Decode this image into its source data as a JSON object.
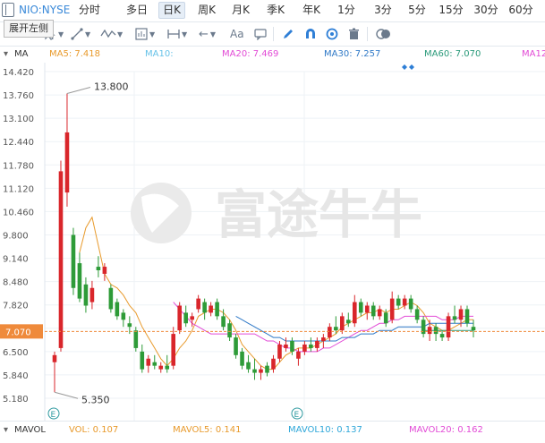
{
  "header": {
    "symbol": "NIO:NYSE",
    "tabs": [
      {
        "label": "分时",
        "active": false
      },
      {
        "label": "多日",
        "active": false
      },
      {
        "label": "日K",
        "active": true
      },
      {
        "label": "周K",
        "active": false
      },
      {
        "label": "月K",
        "active": false
      },
      {
        "label": "季K",
        "active": false
      },
      {
        "label": "年K",
        "active": false
      },
      {
        "label": "1分",
        "active": false
      },
      {
        "label": "3分",
        "active": false
      },
      {
        "label": "5分",
        "active": false
      },
      {
        "label": "15分",
        "active": false
      },
      {
        "label": "30分",
        "active": false
      },
      {
        "label": "60分",
        "active": false
      }
    ]
  },
  "tooltip": "展开左侧",
  "toolbar": {
    "icons": [
      "cursor-icon",
      "trendline-icon",
      "wave-pattern-icon",
      "indicator-icon",
      "measure-icon",
      "arrow-left-icon"
    ],
    "text_tool": "Aa"
  },
  "legend": {
    "ma_label": "MA",
    "ma5": "MA5: 7.418",
    "ma10": "MA10:",
    "ma20": "MA20: 7.469",
    "ma30": "MA30: 7.257",
    "ma60": "MA60: 7.070",
    "ma120": "MA12"
  },
  "colors": {
    "up": "#d9262b",
    "down": "#2e9b38",
    "ma5": "#e89a2c",
    "ma10": "#66c2e8",
    "ma20": "#e24bd6",
    "ma30": "#2f79c7",
    "ma60": "#2a9a7a",
    "price_line": "#ef8a3b",
    "accent": "#2f7fd6"
  },
  "watermark": "富途牛牛",
  "price_axis": {
    "ticks": [
      "14.420",
      "13.760",
      "13.100",
      "12.440",
      "11.780",
      "11.120",
      "10.460",
      "9.800",
      "9.140",
      "8.480",
      "7.820",
      "7.160",
      "6.500",
      "5.840",
      "5.180"
    ],
    "current": "7.070"
  },
  "annotations": {
    "high": "13.800",
    "low": "5.350",
    "event_marker": "E"
  },
  "volume_bar": {
    "label": "MAVOL",
    "vol": "VOL: 0.107",
    "mavol5": "MAVOL5: 0.141",
    "mavol10": "MAVOL10: 0.137",
    "mavol20": "MAVOL20: 0.162"
  },
  "chart_data": {
    "type": "candlestick",
    "ylim": [
      5.18,
      14.42
    ],
    "current_price": 7.07,
    "high": 13.8,
    "low": 5.35,
    "candles": [
      {
        "o": 6.2,
        "h": 6.5,
        "l": 5.35,
        "c": 6.4,
        "up": true
      },
      {
        "o": 6.6,
        "h": 11.9,
        "l": 6.5,
        "c": 11.6,
        "up": true
      },
      {
        "o": 11.0,
        "h": 13.8,
        "l": 10.6,
        "c": 12.7,
        "up": true
      },
      {
        "o": 9.8,
        "h": 10.0,
        "l": 8.1,
        "c": 8.3,
        "up": false
      },
      {
        "o": 9.0,
        "h": 9.3,
        "l": 7.9,
        "c": 8.0,
        "up": false
      },
      {
        "o": 8.4,
        "h": 8.6,
        "l": 7.6,
        "c": 7.8,
        "up": false
      },
      {
        "o": 7.9,
        "h": 8.5,
        "l": 7.7,
        "c": 8.3,
        "up": true
      },
      {
        "o": 8.9,
        "h": 9.2,
        "l": 8.6,
        "c": 8.8,
        "up": false
      },
      {
        "o": 8.7,
        "h": 9.0,
        "l": 8.5,
        "c": 8.9,
        "up": true
      },
      {
        "o": 8.3,
        "h": 8.4,
        "l": 7.6,
        "c": 7.7,
        "up": false
      },
      {
        "o": 7.9,
        "h": 8.0,
        "l": 7.4,
        "c": 7.5,
        "up": false
      },
      {
        "o": 7.6,
        "h": 7.7,
        "l": 7.2,
        "c": 7.4,
        "up": false
      },
      {
        "o": 7.3,
        "h": 7.5,
        "l": 7.0,
        "c": 7.2,
        "up": false
      },
      {
        "o": 7.1,
        "h": 7.2,
        "l": 6.5,
        "c": 6.6,
        "up": false
      },
      {
        "o": 6.5,
        "h": 6.7,
        "l": 5.9,
        "c": 6.0,
        "up": false
      },
      {
        "o": 6.1,
        "h": 6.4,
        "l": 5.9,
        "c": 6.3,
        "up": true
      },
      {
        "o": 6.2,
        "h": 6.4,
        "l": 6.0,
        "c": 6.1,
        "up": false
      },
      {
        "o": 6.0,
        "h": 6.2,
        "l": 5.9,
        "c": 6.1,
        "up": true
      },
      {
        "o": 6.1,
        "h": 6.4,
        "l": 5.9,
        "c": 6.0,
        "up": false
      },
      {
        "o": 6.1,
        "h": 7.2,
        "l": 6.0,
        "c": 7.0,
        "up": true
      },
      {
        "o": 7.1,
        "h": 7.9,
        "l": 7.0,
        "c": 7.8,
        "up": true
      },
      {
        "o": 7.6,
        "h": 7.8,
        "l": 7.2,
        "c": 7.3,
        "up": false
      },
      {
        "o": 7.4,
        "h": 7.6,
        "l": 7.2,
        "c": 7.5,
        "up": true
      },
      {
        "o": 7.7,
        "h": 8.1,
        "l": 7.6,
        "c": 8.0,
        "up": true
      },
      {
        "o": 7.9,
        "h": 8.0,
        "l": 7.4,
        "c": 7.6,
        "up": false
      },
      {
        "o": 7.6,
        "h": 7.9,
        "l": 7.5,
        "c": 7.8,
        "up": true
      },
      {
        "o": 7.9,
        "h": 8.0,
        "l": 7.4,
        "c": 7.5,
        "up": false
      },
      {
        "o": 7.5,
        "h": 7.7,
        "l": 7.1,
        "c": 7.2,
        "up": false
      },
      {
        "o": 7.3,
        "h": 7.4,
        "l": 6.8,
        "c": 6.9,
        "up": false
      },
      {
        "o": 6.9,
        "h": 7.0,
        "l": 6.3,
        "c": 6.4,
        "up": false
      },
      {
        "o": 6.5,
        "h": 6.6,
        "l": 6.0,
        "c": 6.1,
        "up": false
      },
      {
        "o": 6.2,
        "h": 6.4,
        "l": 5.9,
        "c": 6.0,
        "up": false
      },
      {
        "o": 6.0,
        "h": 6.3,
        "l": 5.7,
        "c": 5.9,
        "up": false
      },
      {
        "o": 5.9,
        "h": 6.1,
        "l": 5.7,
        "c": 6.0,
        "up": true
      },
      {
        "o": 6.1,
        "h": 6.2,
        "l": 5.8,
        "c": 5.9,
        "up": false
      },
      {
        "o": 6.0,
        "h": 6.4,
        "l": 5.9,
        "c": 6.3,
        "up": true
      },
      {
        "o": 6.3,
        "h": 6.8,
        "l": 6.2,
        "c": 6.7,
        "up": true
      },
      {
        "o": 6.6,
        "h": 6.9,
        "l": 6.5,
        "c": 6.7,
        "up": true
      },
      {
        "o": 6.8,
        "h": 6.9,
        "l": 6.4,
        "c": 6.5,
        "up": false
      },
      {
        "o": 6.3,
        "h": 6.6,
        "l": 6.1,
        "c": 6.5,
        "up": true
      },
      {
        "o": 6.5,
        "h": 6.8,
        "l": 6.4,
        "c": 6.7,
        "up": true
      },
      {
        "o": 6.7,
        "h": 6.9,
        "l": 6.5,
        "c": 6.6,
        "up": false
      },
      {
        "o": 6.6,
        "h": 6.9,
        "l": 6.5,
        "c": 6.8,
        "up": true
      },
      {
        "o": 6.8,
        "h": 7.0,
        "l": 6.6,
        "c": 6.9,
        "up": true
      },
      {
        "o": 6.9,
        "h": 7.3,
        "l": 6.8,
        "c": 7.2,
        "up": true
      },
      {
        "o": 7.2,
        "h": 7.5,
        "l": 7.0,
        "c": 7.1,
        "up": false
      },
      {
        "o": 7.1,
        "h": 7.6,
        "l": 7.0,
        "c": 7.5,
        "up": true
      },
      {
        "o": 7.4,
        "h": 7.6,
        "l": 7.2,
        "c": 7.3,
        "up": false
      },
      {
        "o": 7.3,
        "h": 8.1,
        "l": 7.2,
        "c": 7.9,
        "up": true
      },
      {
        "o": 7.9,
        "h": 8.0,
        "l": 7.5,
        "c": 7.6,
        "up": false
      },
      {
        "o": 7.6,
        "h": 7.9,
        "l": 7.4,
        "c": 7.8,
        "up": true
      },
      {
        "o": 7.8,
        "h": 7.9,
        "l": 7.4,
        "c": 7.5,
        "up": false
      },
      {
        "o": 7.5,
        "h": 7.8,
        "l": 7.4,
        "c": 7.7,
        "up": true
      },
      {
        "o": 7.6,
        "h": 7.7,
        "l": 7.2,
        "c": 7.3,
        "up": false
      },
      {
        "o": 7.4,
        "h": 8.2,
        "l": 7.3,
        "c": 8.0,
        "up": true
      },
      {
        "o": 8.0,
        "h": 8.1,
        "l": 7.7,
        "c": 7.8,
        "up": false
      },
      {
        "o": 7.8,
        "h": 8.1,
        "l": 7.7,
        "c": 8.0,
        "up": true
      },
      {
        "o": 8.0,
        "h": 8.1,
        "l": 7.6,
        "c": 7.7,
        "up": false
      },
      {
        "o": 7.7,
        "h": 7.8,
        "l": 7.3,
        "c": 7.4,
        "up": false
      },
      {
        "o": 7.4,
        "h": 7.5,
        "l": 6.9,
        "c": 7.0,
        "up": false
      },
      {
        "o": 7.0,
        "h": 7.4,
        "l": 6.8,
        "c": 7.2,
        "up": true
      },
      {
        "o": 7.2,
        "h": 7.3,
        "l": 6.8,
        "c": 7.0,
        "up": false
      },
      {
        "o": 7.0,
        "h": 7.1,
        "l": 6.8,
        "c": 6.9,
        "up": false
      },
      {
        "o": 6.9,
        "h": 7.6,
        "l": 6.8,
        "c": 7.5,
        "up": true
      },
      {
        "o": 7.5,
        "h": 7.8,
        "l": 7.3,
        "c": 7.4,
        "up": false
      },
      {
        "o": 7.4,
        "h": 7.8,
        "l": 7.2,
        "c": 7.7,
        "up": true
      },
      {
        "o": 7.7,
        "h": 7.8,
        "l": 7.2,
        "c": 7.3,
        "up": false
      },
      {
        "o": 7.2,
        "h": 7.4,
        "l": 6.9,
        "c": 7.1,
        "up": false
      }
    ],
    "ma_series": [
      {
        "name": "MA5",
        "values": [
          null,
          null,
          null,
          null,
          9.3,
          10.0,
          10.3,
          9.5,
          8.7,
          8.4,
          8.3,
          8.1,
          7.8,
          7.6,
          7.2,
          6.9,
          6.6,
          6.3,
          6.1,
          6.3,
          6.6,
          6.8,
          7.1,
          7.5,
          7.6,
          7.7,
          7.7,
          7.6,
          7.4,
          7.1,
          6.7,
          6.5,
          6.3,
          6.1,
          6.0,
          6.0,
          6.2,
          6.4,
          6.5,
          6.6,
          6.6,
          6.6,
          6.7,
          6.8,
          6.9,
          7.0,
          7.2,
          7.3,
          7.4,
          7.5,
          7.6,
          7.6,
          7.7,
          7.6,
          7.7,
          7.7,
          7.8,
          7.9,
          7.8,
          7.6,
          7.3,
          7.2,
          7.1,
          7.1,
          7.2,
          7.3,
          7.4,
          7.4
        ]
      },
      {
        "name": "MA20",
        "values": [
          null,
          null,
          null,
          null,
          null,
          null,
          null,
          null,
          null,
          null,
          null,
          null,
          null,
          null,
          null,
          null,
          null,
          null,
          null,
          7.9,
          7.7,
          7.5,
          7.3,
          7.2,
          7.1,
          7.0,
          7.0,
          7.0,
          7.0,
          7.0,
          7.0,
          7.0,
          7.0,
          6.9,
          6.8,
          6.8,
          6.7,
          6.6,
          6.6,
          6.5,
          6.5,
          6.5,
          6.5,
          6.6,
          6.6,
          6.7,
          6.8,
          6.9,
          7.0,
          7.1,
          7.1,
          7.2,
          7.3,
          7.3,
          7.4,
          7.4,
          7.5,
          7.5,
          7.5,
          7.5,
          7.5,
          7.5,
          7.4,
          7.4,
          7.4,
          7.5,
          7.5,
          7.5
        ]
      },
      {
        "name": "MA30",
        "values": [
          null,
          null,
          null,
          null,
          null,
          null,
          null,
          null,
          null,
          null,
          null,
          null,
          null,
          null,
          null,
          null,
          null,
          null,
          null,
          null,
          null,
          null,
          null,
          null,
          null,
          null,
          null,
          null,
          null,
          7.5,
          7.4,
          7.3,
          7.2,
          7.1,
          7.0,
          6.9,
          6.9,
          6.8,
          6.8,
          6.8,
          6.8,
          6.8,
          6.8,
          6.8,
          6.8,
          6.8,
          6.9,
          6.9,
          6.9,
          7.0,
          7.0,
          7.0,
          7.1,
          7.1,
          7.1,
          7.2,
          7.2,
          7.2,
          7.2,
          7.2,
          7.3,
          7.3,
          7.3,
          7.3,
          7.3,
          7.3,
          7.3,
          7.3
        ]
      },
      {
        "name": "MA60",
        "values": [
          null,
          null,
          null,
          null,
          null,
          null,
          null,
          null,
          null,
          null,
          null,
          null,
          null,
          null,
          null,
          null,
          null,
          null,
          null,
          null,
          null,
          null,
          null,
          null,
          null,
          null,
          null,
          null,
          null,
          null,
          null,
          null,
          null,
          null,
          null,
          null,
          null,
          null,
          null,
          null,
          null,
          null,
          null,
          null,
          null,
          null,
          null,
          null,
          null,
          null,
          null,
          null,
          null,
          null,
          null,
          null,
          null,
          null,
          null,
          7.1,
          7.1,
          7.1,
          7.1,
          7.1,
          7.1,
          7.1,
          7.1,
          7.1
        ]
      }
    ]
  }
}
